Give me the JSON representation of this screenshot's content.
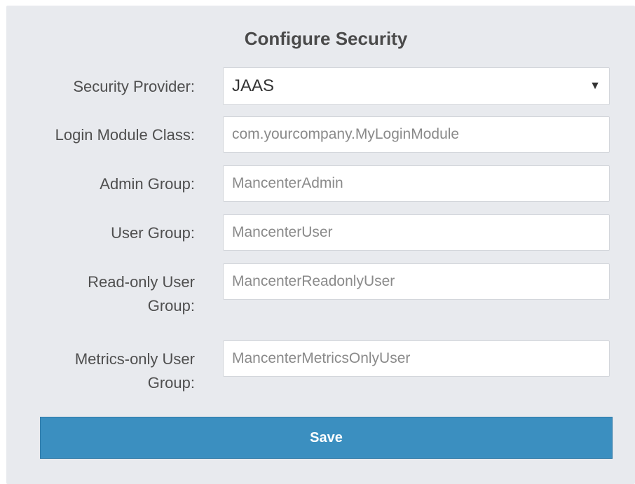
{
  "title": "Configure Security",
  "security_provider": {
    "label": "Security Provider:",
    "value": "JAAS",
    "arrow": "▼"
  },
  "fields": [
    {
      "label": "Login Module Class:",
      "placeholder": "com.yourcompany.MyLoginModule",
      "value": ""
    },
    {
      "label": "Admin Group:",
      "placeholder": "MancenterAdmin",
      "value": ""
    },
    {
      "label": "User Group:",
      "placeholder": "MancenterUser",
      "value": ""
    },
    {
      "label": "Read-only User Group:",
      "placeholder": "MancenterReadonlyUser",
      "value": ""
    },
    {
      "label": "Metrics-only User Group:",
      "placeholder": "MancenterMetricsOnlyUser",
      "value": ""
    }
  ],
  "save_label": "Save"
}
